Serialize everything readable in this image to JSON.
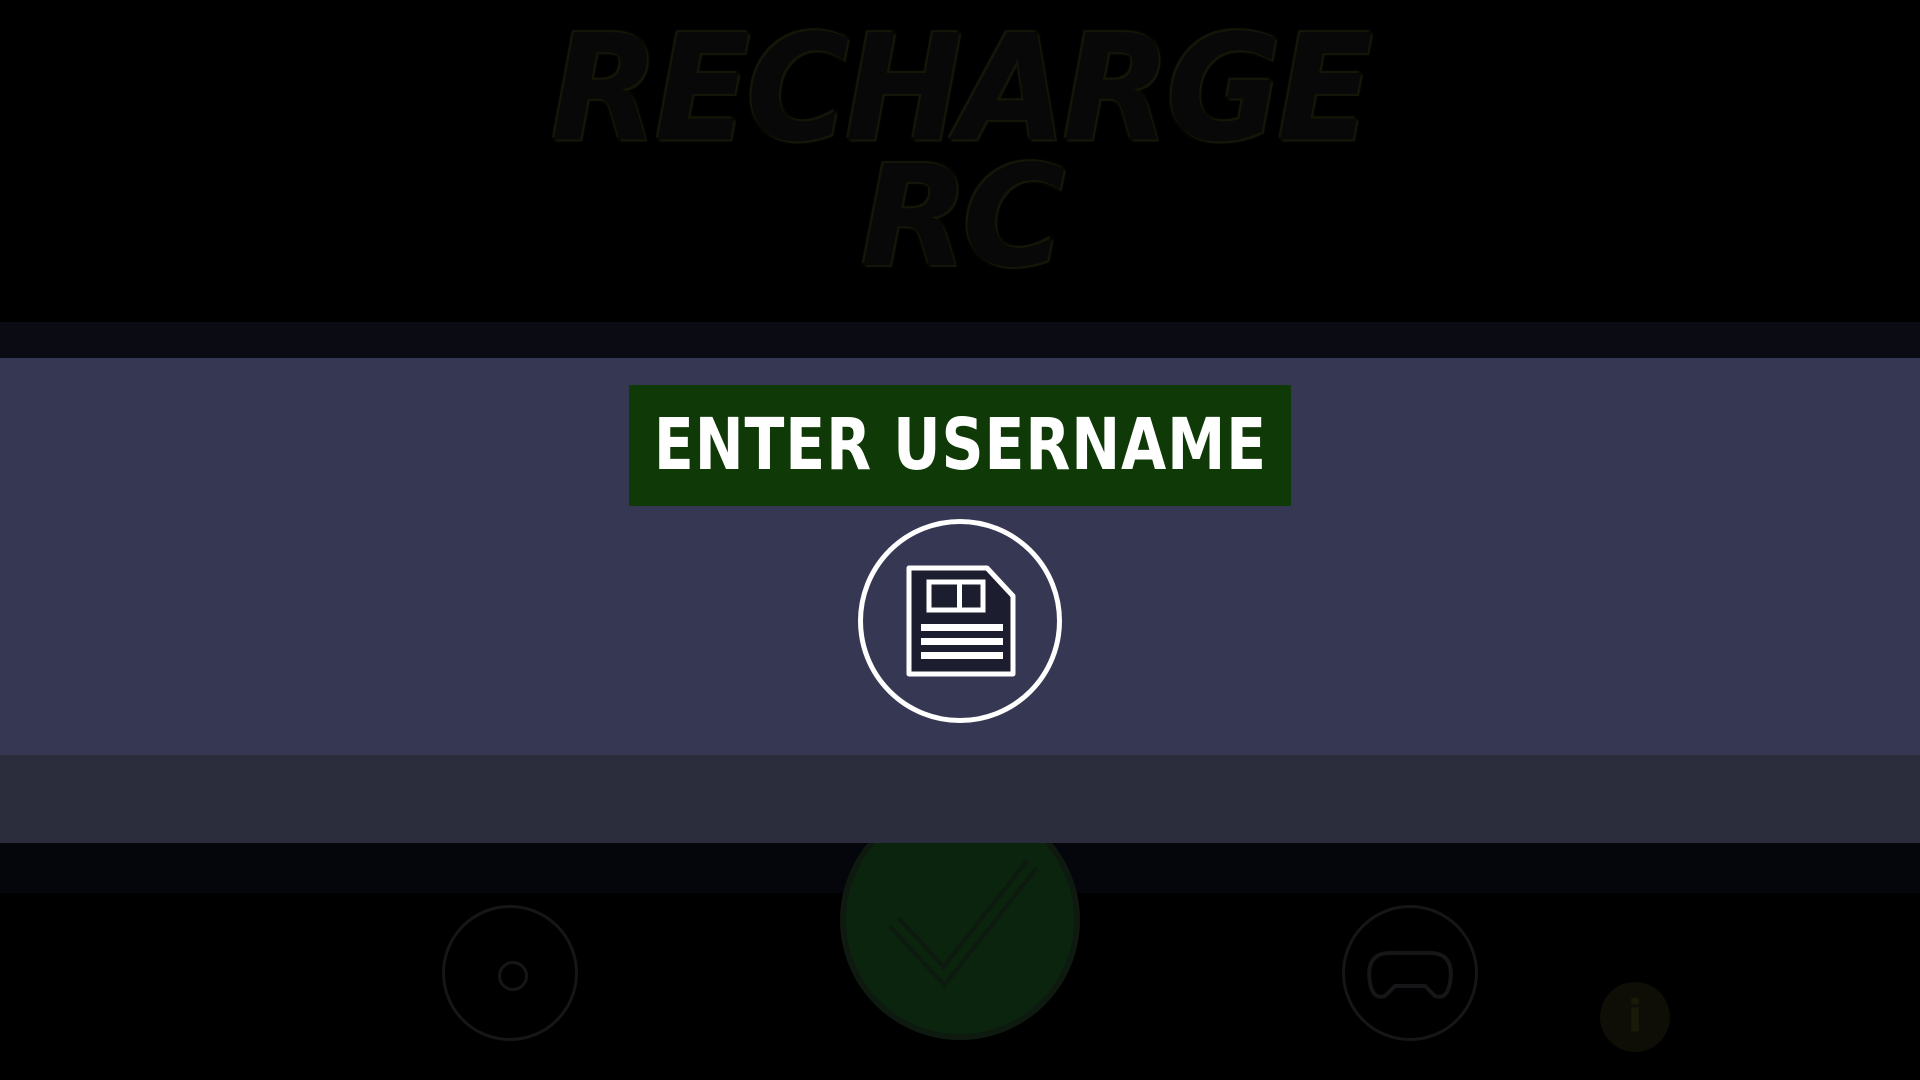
{
  "game": {
    "logo_line1": "RECHARGE",
    "logo_line2": "RC"
  },
  "dialog": {
    "title": "ENTER USERNAME",
    "save_icon": "floppy-disk-icon"
  },
  "menu": {
    "settings_icon": "gear-icon",
    "confirm_icon": "checkmark-icon",
    "controller_icon": "gamepad-icon",
    "info_label": "i"
  },
  "colors": {
    "panel": "#363753",
    "footer": "#2c2d3c",
    "title_bg": "#0f3a07",
    "title_text": "#ffffff"
  }
}
